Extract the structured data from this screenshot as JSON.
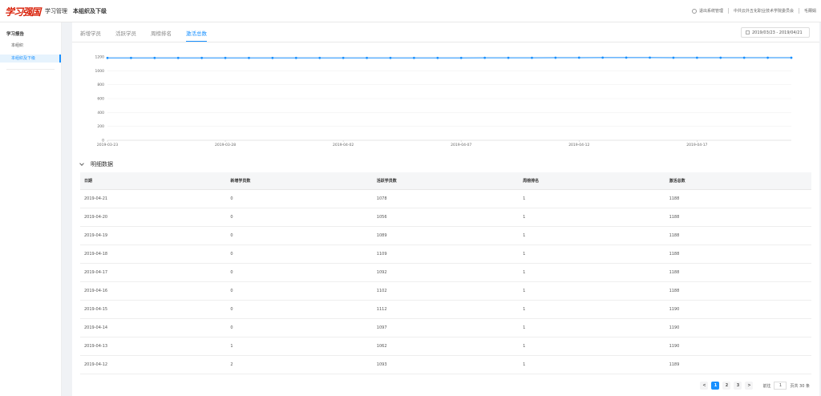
{
  "header": {
    "logo_text": "学习强国",
    "app_title": "学习管理",
    "page_title": "本组织及下级",
    "links": [
      "退出系统管理",
      "中共云外五化职业技术学院委员会",
      "毛爾娟"
    ]
  },
  "sidebar": {
    "group_label": "学习报告",
    "items": [
      {
        "label": "本组织"
      },
      {
        "label": "本组织及下级"
      }
    ]
  },
  "tabs": [
    "新增学员",
    "活跃学员",
    "周榜排名",
    "激活总数"
  ],
  "date_range": "2019/03/23 - 2019/04/21",
  "chart_data": {
    "type": "line",
    "x_ticks": [
      "2019-03-23",
      "2019-03-28",
      "2019-04-02",
      "2019-04-07",
      "2019-04-12",
      "2019-04-17"
    ],
    "y_ticks": [
      "0",
      "200",
      "400",
      "600",
      "800",
      "1000",
      "1200"
    ],
    "ylim": [
      0,
      1200
    ],
    "x": [
      "03-23",
      "03-24",
      "03-25",
      "03-26",
      "03-27",
      "03-28",
      "03-29",
      "03-30",
      "03-31",
      "04-01",
      "04-02",
      "04-03",
      "04-04",
      "04-05",
      "04-06",
      "04-07",
      "04-08",
      "04-09",
      "04-10",
      "04-11",
      "04-12",
      "04-13",
      "04-14",
      "04-15",
      "04-16",
      "04-17",
      "04-18",
      "04-19",
      "04-20",
      "04-21"
    ],
    "values": [
      1185,
      1185,
      1185,
      1185,
      1185,
      1185,
      1185,
      1185,
      1185,
      1185,
      1186,
      1186,
      1186,
      1186,
      1186,
      1186,
      1187,
      1187,
      1187,
      1188,
      1189,
      1190,
      1190,
      1190,
      1188,
      1188,
      1188,
      1188,
      1188,
      1188
    ],
    "color": "#1890ff",
    "grid": true
  },
  "detail": {
    "title": "明细数据",
    "columns": [
      "日期",
      "新增学员数",
      "活跃学员数",
      "周榜排名",
      "激活总数"
    ],
    "rows": [
      [
        "2019-04-21",
        "0",
        "1078",
        "1",
        "1188"
      ],
      [
        "2019-04-20",
        "0",
        "1056",
        "1",
        "1188"
      ],
      [
        "2019-04-19",
        "0",
        "1089",
        "1",
        "1188"
      ],
      [
        "2019-04-18",
        "0",
        "1109",
        "1",
        "1188"
      ],
      [
        "2019-04-17",
        "0",
        "1092",
        "1",
        "1188"
      ],
      [
        "2019-04-16",
        "0",
        "1102",
        "1",
        "1188"
      ],
      [
        "2019-04-15",
        "0",
        "1112",
        "1",
        "1190"
      ],
      [
        "2019-04-14",
        "0",
        "1097",
        "1",
        "1190"
      ],
      [
        "2019-04-13",
        "1",
        "1062",
        "1",
        "1190"
      ],
      [
        "2019-04-12",
        "2",
        "1093",
        "1",
        "1189"
      ]
    ]
  },
  "pagination": {
    "prev": "<",
    "pages": [
      "1",
      "2",
      "3"
    ],
    "next": ">",
    "goto_label": "前往",
    "goto_value": "1",
    "total": "页共 30 条"
  }
}
